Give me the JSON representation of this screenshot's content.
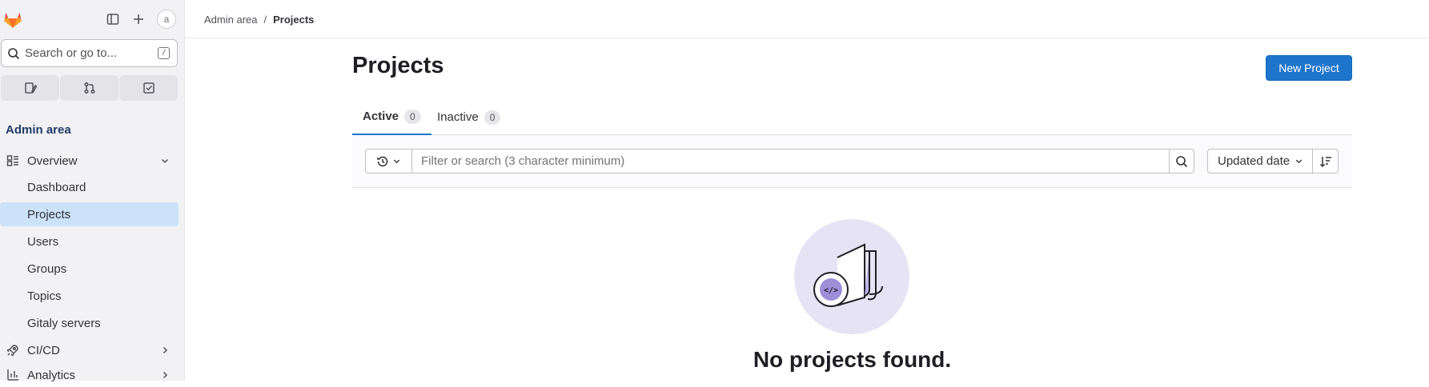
{
  "sidebar": {
    "search_placeholder": "Search or go to...",
    "search_shortcut": "/",
    "avatar_alt": "a",
    "section_title": "Admin area",
    "items": [
      {
        "label": "Overview",
        "type": "parent",
        "icon": "overview-icon",
        "expanded": true
      },
      {
        "label": "Dashboard",
        "type": "child"
      },
      {
        "label": "Projects",
        "type": "child",
        "active": true
      },
      {
        "label": "Users",
        "type": "child"
      },
      {
        "label": "Groups",
        "type": "child"
      },
      {
        "label": "Topics",
        "type": "child"
      },
      {
        "label": "Gitaly servers",
        "type": "child"
      },
      {
        "label": "CI/CD",
        "type": "parent",
        "icon": "rocket-icon"
      },
      {
        "label": "Analytics",
        "type": "parent",
        "icon": "analytics-icon"
      }
    ]
  },
  "breadcrumb": {
    "root": "Admin area",
    "separator": "/",
    "current": "Projects"
  },
  "page": {
    "title": "Projects",
    "new_button": "New Project",
    "tabs": [
      {
        "label": "Active",
        "count": "0",
        "active": true
      },
      {
        "label": "Inactive",
        "count": "0",
        "active": false
      }
    ],
    "filter_placeholder": "Filter or search (3 character minimum)",
    "sort_label": "Updated date",
    "empty_title": "No projects found."
  },
  "colors": {
    "accent": "#1f75cb",
    "active_nav": "#cbe2f9",
    "sidebar_bg": "#f2f2f4"
  }
}
